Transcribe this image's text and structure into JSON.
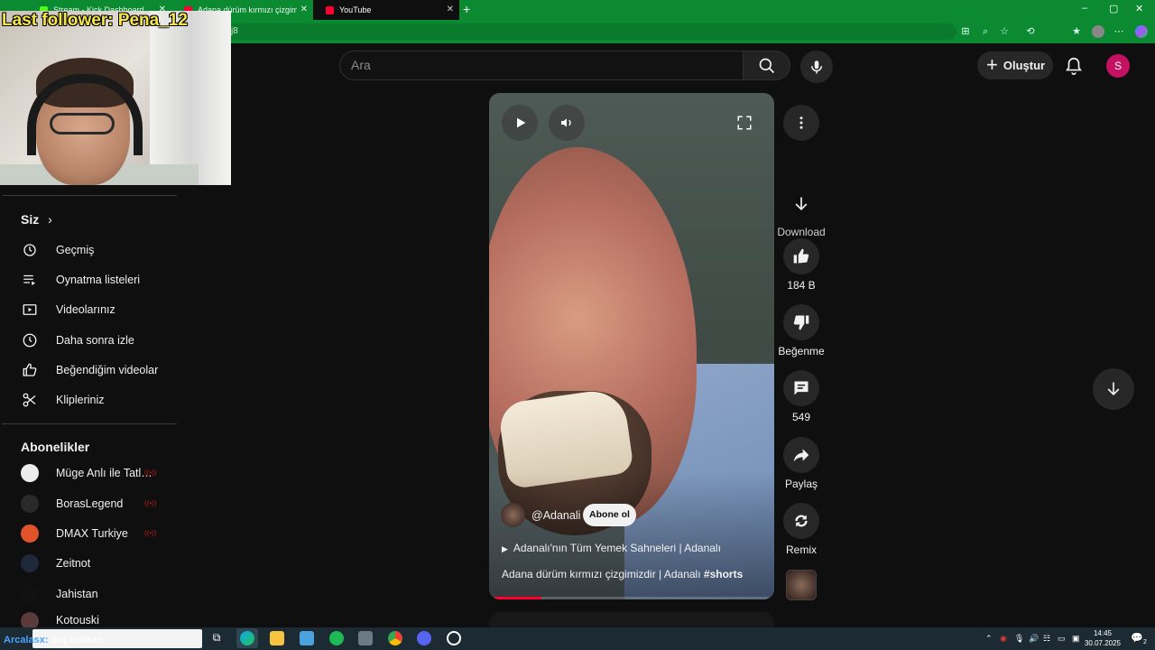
{
  "browser": {
    "tabs": [
      {
        "title": "Stream - Kick Dashboard",
        "favicon_color": "#53fc18"
      },
      {
        "title": "Adana dürüm kırmızı çizgimi",
        "favicon_color": "#ff0033"
      },
      {
        "title": "YouTube",
        "favicon_color": "#ff0033"
      }
    ],
    "new_tab": "+",
    "url_fragment": "j8",
    "window_controls": [
      "–",
      "▢",
      "✕"
    ]
  },
  "stream_overlay": {
    "follower_text": "Last follower: Pena_12"
  },
  "header": {
    "search_placeholder": "Ara",
    "create_label": "Oluştur",
    "avatar_letter": "S",
    "avatar_color": "#c51162"
  },
  "sidebar": {
    "you_heading": "Siz",
    "you_items": [
      {
        "label": "Geçmiş",
        "icon": "history-icon"
      },
      {
        "label": "Oynatma listeleri",
        "icon": "playlists-icon"
      },
      {
        "label": "Videolarınız",
        "icon": "your-videos-icon"
      },
      {
        "label": "Daha sonra izle",
        "icon": "watch-later-icon"
      },
      {
        "label": "Beğendiğim videolar",
        "icon": "liked-videos-icon"
      },
      {
        "label": "Klipleriniz",
        "icon": "clips-icon"
      }
    ],
    "subs_heading": "Abonelikler",
    "subscriptions": [
      {
        "label": "Müge Anlı ile Tatl…",
        "live": true,
        "avatar_color": "#ececec"
      },
      {
        "label": "BorasLegend",
        "live": true,
        "avatar_color": "#2a2a2a"
      },
      {
        "label": "DMAX Turkiye",
        "live": true,
        "avatar_color": "#e0522a"
      },
      {
        "label": "Zeitnot",
        "live": false,
        "avatar_color": "#1e2a3a"
      },
      {
        "label": "Jahistan",
        "live": false,
        "avatar_color": "#111111"
      },
      {
        "label": "Kotouski",
        "live": false,
        "avatar_color": "#5a3a3a"
      }
    ]
  },
  "short": {
    "channel": "@Adanali",
    "subscribe_label": "Abone ol",
    "playlist": "Adanalı'nın Tüm Yemek Sahneleri | Adanalı",
    "title": "Adana dürüm kırmızı çizgimizdir | Adanalı",
    "hashtag": "#shorts",
    "progress_fraction": 0.17
  },
  "actions": {
    "download_label": "Download",
    "like_count": "184 B",
    "dislike_label": "Beğenme",
    "comment_count": "549",
    "share_label": "Paylaş",
    "remix_label": "Remix"
  },
  "taskbar": {
    "chat_user": "Arcalasx:",
    "chat_message": "hoş buldum",
    "time": "14:45",
    "date": "30.07.2025",
    "notification_count": "2"
  }
}
